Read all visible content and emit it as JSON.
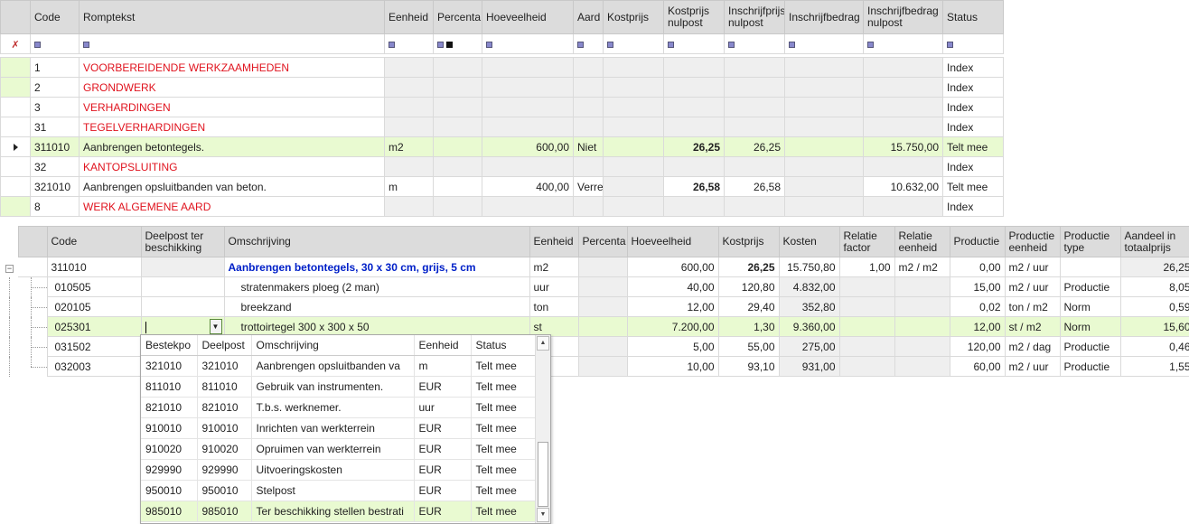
{
  "top_grid": {
    "columns": [
      "Code",
      "Romptekst",
      "Eenheid",
      "Percenta",
      "Hoeveelheid",
      "Aard",
      "Kostprijs",
      "Kostprijs nulpost",
      "Inschrijfprijs nulpost",
      "Inschrijfbedrag",
      "Inschrijfbedrag nulpost",
      "Status"
    ],
    "rows": [
      {
        "code": "1",
        "text": "VOORBEREIDENDE WERKZAAMHEDEN",
        "eenheid": "",
        "hoeveelheid": "",
        "aard": "",
        "kostprijs": "",
        "kostprijs_nulpost": "",
        "inschr_prijs": "",
        "inschr_bedrag": "",
        "inschr_bedrag_nulpost": "",
        "status": "Index"
      },
      {
        "code": "2",
        "text": "GRONDWERK",
        "eenheid": "",
        "hoeveelheid": "",
        "aard": "",
        "kostprijs": "",
        "kostprijs_nulpost": "",
        "inschr_prijs": "",
        "inschr_bedrag": "",
        "inschr_bedrag_nulpost": "",
        "status": "Index"
      },
      {
        "code": "3",
        "text": "VERHARDINGEN",
        "eenheid": "",
        "hoeveelheid": "",
        "aard": "",
        "kostprijs": "",
        "kostprijs_nulpost": "",
        "inschr_prijs": "",
        "inschr_bedrag": "",
        "inschr_bedrag_nulpost": "",
        "status": "Index"
      },
      {
        "code": "31",
        "text": "TEGELVERHARDINGEN",
        "eenheid": "",
        "hoeveelheid": "",
        "aard": "",
        "kostprijs": "",
        "kostprijs_nulpost": "",
        "inschr_prijs": "",
        "inschr_bedrag": "",
        "inschr_bedrag_nulpost": "",
        "status": "Index"
      },
      {
        "code": "311010",
        "text": "Aanbrengen betontegels.",
        "eenheid": "m2",
        "hoeveelheid": "600,00",
        "aard": "Niet",
        "kostprijs": "",
        "kostprijs_nulpost": "26,25",
        "inschr_prijs": "26,25",
        "inschr_bedrag": "",
        "inschr_bedrag_nulpost": "15.750,00",
        "status": "Telt mee"
      },
      {
        "code": "32",
        "text": "KANTOPSLUITING",
        "eenheid": "",
        "hoeveelheid": "",
        "aard": "",
        "kostprijs": "",
        "kostprijs_nulpost": "",
        "inschr_prijs": "",
        "inschr_bedrag": "",
        "inschr_bedrag_nulpost": "",
        "status": "Index"
      },
      {
        "code": "321010",
        "text": "Aanbrengen opsluitbanden van beton.",
        "eenheid": "m",
        "hoeveelheid": "400,00",
        "aard": "Verre",
        "kostprijs": "",
        "kostprijs_nulpost": "26,58",
        "inschr_prijs": "26,58",
        "inschr_bedrag": "",
        "inschr_bedrag_nulpost": "10.632,00",
        "status": "Telt mee"
      },
      {
        "code": "8",
        "text": "WERK ALGEMENE AARD",
        "eenheid": "",
        "hoeveelheid": "",
        "aard": "",
        "kostprijs": "",
        "kostprijs_nulpost": "",
        "inschr_prijs": "",
        "inschr_bedrag": "",
        "inschr_bedrag_nulpost": "",
        "status": "Index"
      }
    ]
  },
  "bottom_grid": {
    "columns": [
      "Code",
      "Deelpost ter beschikking",
      "Omschrijving",
      "Eenheid",
      "Percenta",
      "Hoeveelheid",
      "Kostprijs",
      "Kosten",
      "Relatie factor",
      "Relatie eenheid",
      "Productie",
      "Productie eenheid",
      "Productie type",
      "Aandeel in totaalprijs"
    ],
    "parent": {
      "expander": "−",
      "code": "311010",
      "omschrijving": "Aanbrengen betontegels, 30 x 30 cm, grijs, 5 cm",
      "eenheid": "m2",
      "hoeveelheid": "600,00",
      "kostprijs": "26,25",
      "kosten": "15.750,80",
      "relatie_factor": "1,00",
      "relatie_eenheid": "m2 / m2",
      "productie": "0,00",
      "productie_eenheid": "m2 / uur",
      "productie_type": "",
      "aandeel": "26,25"
    },
    "children": [
      {
        "code": "010505",
        "omschrijving": "stratenmakers ploeg (2 man)",
        "eenheid": "uur",
        "hoeveelheid": "40,00",
        "kostprijs": "120,80",
        "kosten": "4.832,00",
        "productie": "15,00",
        "productie_eenheid": "m2 / uur",
        "productie_type": "Productie",
        "aandeel": "8,05"
      },
      {
        "code": "020105",
        "omschrijving": "breekzand",
        "eenheid": "ton",
        "hoeveelheid": "12,00",
        "kostprijs": "29,40",
        "kosten": "352,80",
        "productie": "0,02",
        "productie_eenheid": "ton / m2",
        "productie_type": "Norm",
        "aandeel": "0,59"
      },
      {
        "code": "025301",
        "omschrijving": "trottoirtegel 300 x 300 x 50",
        "eenheid": "st",
        "hoeveelheid": "7.200,00",
        "kostprijs": "1,30",
        "kosten": "9.360,00",
        "productie": "12,00",
        "productie_eenheid": "st / m2",
        "productie_type": "Norm",
        "aandeel": "15,60"
      },
      {
        "code": "031502",
        "omschrijving": "",
        "eenheid": "",
        "hoeveelheid": "5,00",
        "kostprijs": "55,00",
        "kosten": "275,00",
        "productie": "120,00",
        "productie_eenheid": "m2 / dag",
        "productie_type": "Productie",
        "aandeel": "0,46"
      },
      {
        "code": "032003",
        "omschrijving": "",
        "eenheid": "",
        "hoeveelheid": "10,00",
        "kostprijs": "93,10",
        "kosten": "931,00",
        "productie": "60,00",
        "productie_eenheid": "m2 / uur",
        "productie_type": "Productie",
        "aandeel": "1,55"
      }
    ]
  },
  "dropdown": {
    "columns": [
      "Bestekpo",
      "Deelpost",
      "Omschrijving",
      "Eenheid",
      "Status"
    ],
    "rows": [
      [
        "321010",
        "321010",
        "Aanbrengen opsluitbanden va",
        "m",
        "Telt mee"
      ],
      [
        "811010",
        "811010",
        "Gebruik van instrumenten.",
        "EUR",
        "Telt mee"
      ],
      [
        "821010",
        "821010",
        "T.b.s. werknemer.",
        "uur",
        "Telt mee"
      ],
      [
        "910010",
        "910010",
        "Inrichten van werkterrein",
        "EUR",
        "Telt mee"
      ],
      [
        "910020",
        "910020",
        "Opruimen van werkterrein",
        "EUR",
        "Telt mee"
      ],
      [
        "929990",
        "929990",
        "Uitvoeringskosten",
        "EUR",
        "Telt mee"
      ],
      [
        "950010",
        "950010",
        "Stelpost",
        "EUR",
        "Telt mee"
      ],
      [
        "985010",
        "985010",
        "Ter beschikking stellen bestrati",
        "EUR",
        "Telt mee"
      ]
    ]
  },
  "icons": {
    "pin": "pin-icon",
    "filter": "filter-icon",
    "row_indicator": "row-indicator-arrow-icon",
    "dropdown": "chevron-down-icon",
    "scroll_up": "scroll-up-icon",
    "scroll_down": "scroll-down-icon"
  },
  "colors": {
    "selected_row": "#e9fad1",
    "header": "#dcdcdc",
    "index_text": "#e0131e",
    "parent_text": "#0020c8"
  }
}
